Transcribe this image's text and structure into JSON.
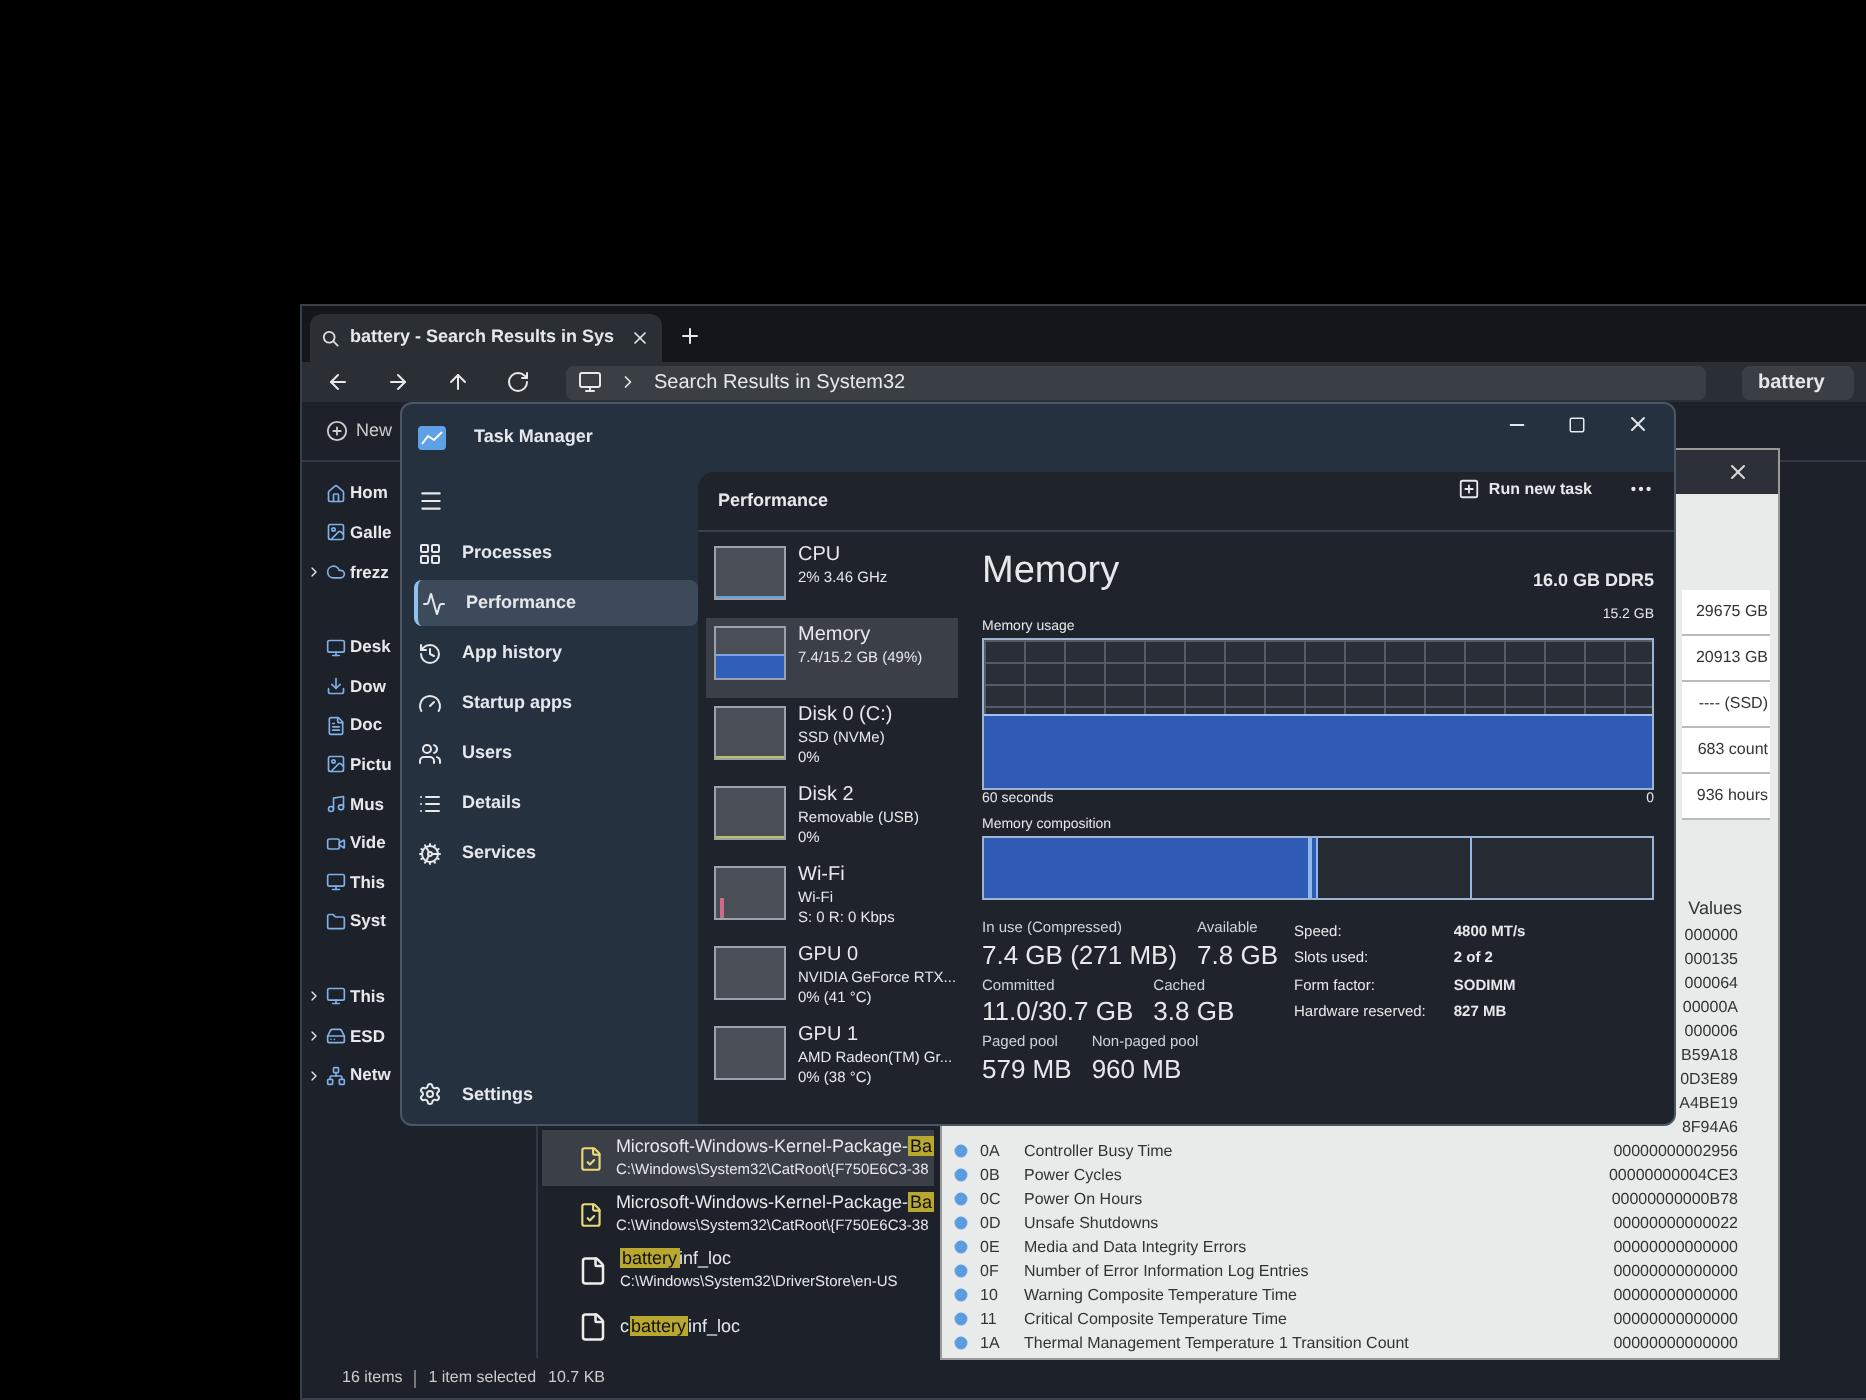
{
  "explorer": {
    "tab_title": "battery - Search Results in Sys",
    "address": "Search Results in System32",
    "search_value": "battery",
    "toolbar_new": "New",
    "sidebar": [
      {
        "label": "Hom",
        "kind": "home",
        "expandable": false
      },
      {
        "label": "Galle",
        "kind": "gallery",
        "expandable": false
      },
      {
        "label": "frezz",
        "kind": "cloud",
        "expandable": true
      },
      {
        "label": "Desk",
        "kind": "desktop",
        "expandable": false
      },
      {
        "label": "Dow",
        "kind": "download",
        "expandable": false
      },
      {
        "label": "Doc",
        "kind": "document",
        "expandable": false
      },
      {
        "label": "Pictu",
        "kind": "gallery",
        "expandable": false
      },
      {
        "label": "Mus",
        "kind": "music",
        "expandable": false
      },
      {
        "label": "Vide",
        "kind": "video",
        "expandable": false
      },
      {
        "label": "This",
        "kind": "desktop",
        "expandable": false
      },
      {
        "label": "Syst",
        "kind": "folder",
        "expandable": false
      },
      {
        "label": "This",
        "kind": "desktop",
        "expandable": true
      },
      {
        "label": "ESD",
        "kind": "drive",
        "expandable": true
      },
      {
        "label": "Netw",
        "kind": "network",
        "expandable": true
      }
    ],
    "files": [
      {
        "name_parts": [
          {
            "text": "Microsoft-Windows-Kernel-Package-",
            "highlighted": false
          },
          {
            "text": "Ba",
            "highlighted": true
          }
        ],
        "path": "C:\\Windows\\System32\\CatRoot\\{F750E6C3-38",
        "selected": true,
        "kind": "catalog"
      },
      {
        "name_parts": [
          {
            "text": "Microsoft-Windows-Kernel-Package-",
            "highlighted": false
          },
          {
            "text": "Ba",
            "highlighted": true
          }
        ],
        "path": "C:\\Windows\\System32\\CatRoot\\{F750E6C3-38",
        "selected": false,
        "kind": "catalog"
      },
      {
        "name_parts": [
          {
            "text": "battery",
            "highlighted": true
          },
          {
            "text": "inf_loc",
            "highlighted": false
          }
        ],
        "path": "C:\\Windows\\System32\\DriverStore\\en-US",
        "selected": false,
        "kind": "file"
      },
      {
        "name_parts": [
          {
            "text": "c",
            "highlighted": false
          },
          {
            "text": "battery",
            "highlighted": true
          },
          {
            "text": "inf_loc",
            "highlighted": false
          }
        ],
        "selected": false,
        "kind": "file"
      }
    ],
    "status": {
      "count": "16 items",
      "selection": "1 item selected",
      "size": "10.7 KB"
    }
  },
  "disk_info": {
    "summary": [
      "29675 GB",
      "20913 GB",
      "---- (SSD)",
      "683 count",
      "936 hours"
    ],
    "values_header": "Values",
    "rows": [
      {
        "raw": "000000"
      },
      {
        "raw": "000135"
      },
      {
        "raw": "000064"
      },
      {
        "raw": "00000A"
      },
      {
        "raw": "000006"
      },
      {
        "raw": "B59A18"
      },
      {
        "raw": "0D3E89"
      },
      {
        "raw": "A4BE19"
      },
      {
        "raw": "8F94A6"
      },
      {
        "id": "0A",
        "attribute": "Controller Busy Time",
        "raw": "00000000002956"
      },
      {
        "id": "0B",
        "attribute": "Power Cycles",
        "raw": "00000000004CE3"
      },
      {
        "id": "0C",
        "attribute": "Power On Hours",
        "raw": "00000000000B78"
      },
      {
        "id": "0D",
        "attribute": "Unsafe Shutdowns",
        "raw": "00000000000022"
      },
      {
        "id": "0E",
        "attribute": "Media and Data Integrity Errors",
        "raw": "00000000000000"
      },
      {
        "id": "0F",
        "attribute": "Number of Error Information Log Entries",
        "raw": "00000000000000"
      },
      {
        "id": "10",
        "attribute": "Warning Composite Temperature Time",
        "raw": "00000000000000"
      },
      {
        "id": "11",
        "attribute": "Critical Composite Temperature Time",
        "raw": "00000000000000"
      },
      {
        "id": "1A",
        "attribute": "Thermal Management Temperature 1 Transition Count",
        "raw": "00000000000000"
      }
    ]
  },
  "task_manager": {
    "title": "Task Manager",
    "nav": [
      {
        "label": "Processes",
        "kind": "processes",
        "selected": false
      },
      {
        "label": "Performance",
        "kind": "performance",
        "selected": true
      },
      {
        "label": "App history",
        "kind": "history",
        "selected": false
      },
      {
        "label": "Startup apps",
        "kind": "startup",
        "selected": false
      },
      {
        "label": "Users",
        "kind": "users",
        "selected": false
      },
      {
        "label": "Details",
        "kind": "details",
        "selected": false
      },
      {
        "label": "Services",
        "kind": "services",
        "selected": false
      }
    ],
    "settings": "Settings",
    "page_title": "Performance",
    "run_new_task": "Run new task",
    "devices": [
      {
        "name": "CPU",
        "lines": [
          "2% 3.46 GHz"
        ],
        "kind": "cpu",
        "selected": false
      },
      {
        "name": "Memory",
        "lines": [
          "7.4/15.2 GB (49%)"
        ],
        "kind": "memory",
        "selected": true
      },
      {
        "name": "Disk 0 (C:)",
        "lines": [
          "SSD (NVMe)",
          "0%"
        ],
        "kind": "disk",
        "selected": false
      },
      {
        "name": "Disk 2",
        "lines": [
          "Removable (USB)",
          "0%"
        ],
        "kind": "disk",
        "selected": false
      },
      {
        "name": "Wi-Fi",
        "lines": [
          "Wi-Fi",
          "S: 0 R: 0 Kbps"
        ],
        "kind": "network",
        "selected": false
      },
      {
        "name": "GPU 0",
        "lines": [
          "NVIDIA GeForce RTX...",
          "0% (41 °C)"
        ],
        "kind": "gpu",
        "selected": false
      },
      {
        "name": "GPU 1",
        "lines": [
          "AMD Radeon(TM) Gr...",
          "0% (38 °C)"
        ],
        "kind": "gpu",
        "selected": false
      }
    ],
    "detail": {
      "title": "Memory",
      "spec": "16.0 GB DDR5",
      "usage_label": "Memory usage",
      "usage_max": "15.2 GB",
      "time_label": "60 seconds",
      "usage_min": "0",
      "composition_label": "Memory composition",
      "stats": [
        [
          {
            "label": "In use (Compressed)",
            "value": "7.4 GB (271 MB)"
          },
          {
            "label": "Available",
            "value": "7.8 GB"
          }
        ],
        [
          {
            "label": "Committed",
            "value": "11.0/30.7 GB"
          },
          {
            "label": "Cached",
            "value": "3.8 GB"
          }
        ],
        [
          {
            "label": "Paged pool",
            "value": "579 MB"
          },
          {
            "label": "Non-paged pool",
            "value": "960 MB"
          }
        ]
      ],
      "specs": [
        {
          "key": "Speed:",
          "value": "4800 MT/s"
        },
        {
          "key": "Slots used:",
          "value": "2 of 2"
        },
        {
          "key": "Form factor:",
          "value": "SODIMM"
        },
        {
          "key": "Hardware reserved:",
          "value": "827 MB"
        }
      ]
    }
  }
}
